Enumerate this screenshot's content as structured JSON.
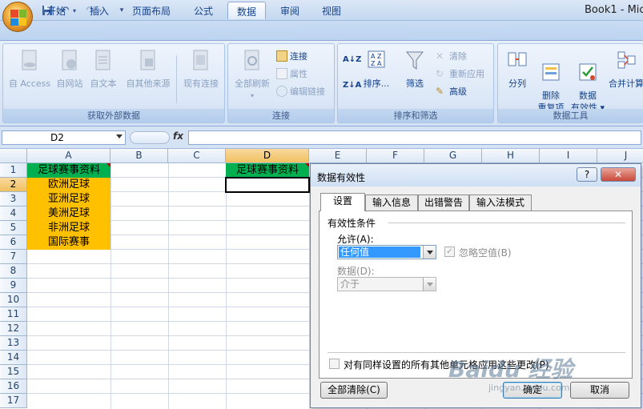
{
  "app": {
    "title": "Book1 - Mic"
  },
  "ribbon_tabs": [
    "开始",
    "插入",
    "页面布局",
    "公式",
    "数据",
    "审阅",
    "视图"
  ],
  "active_tab": "数据",
  "groups": {
    "external": {
      "label": "获取外部数据",
      "buttons": [
        "自 Access",
        "自网站",
        "自文本",
        "自其他来源",
        "现有连接"
      ]
    },
    "connections": {
      "label": "连接",
      "refresh": "全部刷新",
      "items": [
        "连接",
        "属性",
        "编辑链接"
      ]
    },
    "sort_filter": {
      "label": "排序和筛选",
      "sort": "排序...",
      "filter": "筛选",
      "items": [
        "清除",
        "重新应用",
        "高级"
      ]
    },
    "tools": {
      "label": "数据工具",
      "split": "分列",
      "dedupe": "删除\n重复项",
      "validation": "数据\n有效性 ▾",
      "consolidate": "合并计算"
    }
  },
  "namebox": {
    "value": "D2"
  },
  "fx_label": "fx",
  "columns": [
    "A",
    "B",
    "C",
    "D",
    "E",
    "F",
    "G",
    "H",
    "I",
    "J"
  ],
  "rows": [
    "1",
    "2",
    "3",
    "4",
    "5",
    "6",
    "7",
    "8",
    "9",
    "10",
    "11",
    "12",
    "13",
    "14",
    "15",
    "16",
    "17"
  ],
  "cells": {
    "A1": "足球赛事资料",
    "A2": "欧洲足球",
    "A3": "亚洲足球",
    "A4": "美洲足球",
    "A5": "非洲足球",
    "A6": "国际赛事",
    "D1": "足球赛事资料"
  },
  "colors": {
    "header_green": "#00b050",
    "fill_orange": "#ffc000",
    "selection": "#f1c15f"
  },
  "dialog": {
    "title": "数据有效性",
    "help": "?",
    "close": "✕",
    "tabs": [
      "设置",
      "输入信息",
      "出错警告",
      "输入法模式"
    ],
    "active_tab": "设置",
    "section": "有效性条件",
    "allow_label": "允许(A):",
    "allow_value": "任何值",
    "ignore_blank": "忽略空值(B)",
    "data_label": "数据(D):",
    "data_value": "介于",
    "apply_all": "对有同样设置的所有其他单元格应用这些更改(P)",
    "clear_all": "全部清除(C)",
    "ok": "确定",
    "cancel": "取消"
  },
  "watermark": {
    "text": "Baidu 经验",
    "sub": "jingyan.baidu.com"
  }
}
